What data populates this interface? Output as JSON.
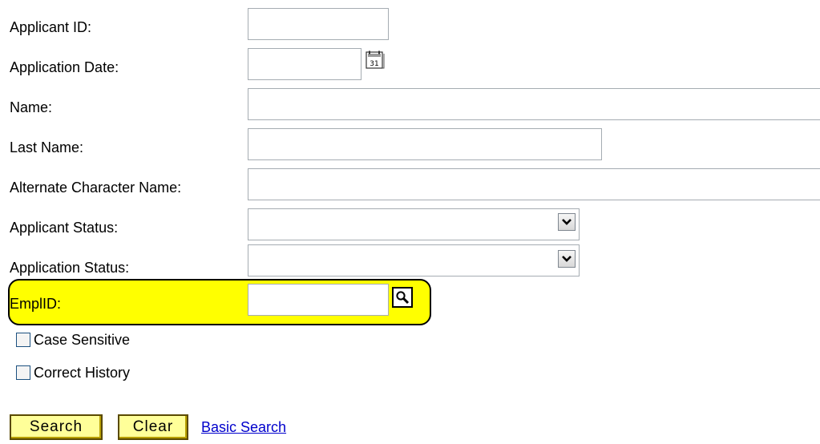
{
  "form": {
    "fields": {
      "applicant_id": {
        "label": "Applicant ID:",
        "value": ""
      },
      "application_date": {
        "label": "Application Date:",
        "value": ""
      },
      "name": {
        "label": "Name:",
        "value": ""
      },
      "last_name": {
        "label": "Last Name:",
        "value": ""
      },
      "alternate_character_name": {
        "label": "Alternate Character Name:",
        "value": ""
      },
      "applicant_status": {
        "label": "Applicant Status:",
        "value": ""
      },
      "application_status": {
        "label": "Application Status:",
        "value": ""
      },
      "emplid": {
        "label": "EmplID:",
        "value": ""
      }
    },
    "checkboxes": {
      "case_sensitive": {
        "label": "Case Sensitive",
        "checked": false
      },
      "correct_history": {
        "label": "Correct History",
        "checked": false
      }
    },
    "buttons": {
      "search_label": "Search",
      "clear_label": "Clear",
      "basic_search_label": "Basic Search"
    }
  },
  "icons": {
    "calendar": "calendar-icon",
    "calendar_day": "31",
    "dropdown": "chevron-down-icon",
    "lookup": "magnifier-icon"
  },
  "colors": {
    "highlight": "#ffff00",
    "button_fill": "#ffff99",
    "link": "#0000cc",
    "field_border": "#a5acb2"
  }
}
